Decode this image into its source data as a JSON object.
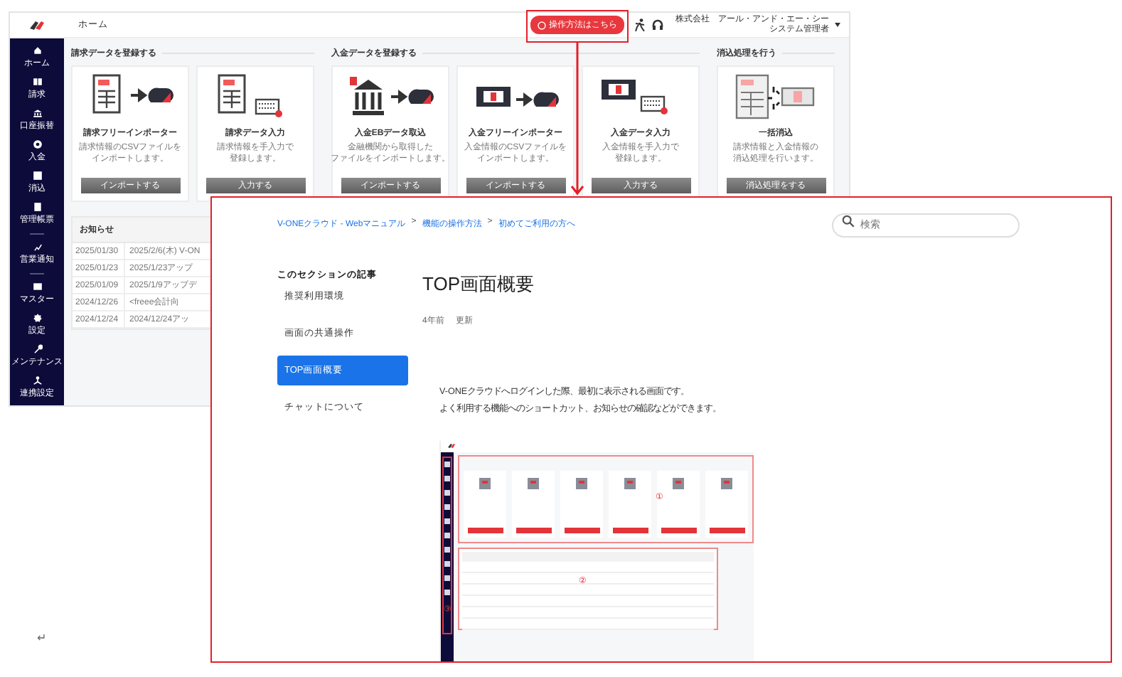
{
  "app": {
    "title": "ホーム",
    "help_button": "操作方法はこちら",
    "company": "株式会社　アール・アンド・エー・シー",
    "role": "システム管理者"
  },
  "sidebar": {
    "groups": [
      {
        "items": [
          "ホーム",
          "請求",
          "口座振替",
          "入金",
          "消込",
          "管理帳票"
        ]
      },
      {
        "items": [
          "営業通知"
        ]
      },
      {
        "items": [
          "マスター",
          "設定",
          "メンテナンス",
          "連携設定"
        ]
      }
    ]
  },
  "sections": [
    {
      "title": "請求データを登録する",
      "cards": [
        {
          "title": "請求フリーインポーター",
          "description_lines": [
            "請求情報のCSVファイルを",
            "インポートします。"
          ],
          "button": "インポートする"
        },
        {
          "title": "請求データ入力",
          "description_lines": [
            "請求情報を手入力で",
            "登録します。"
          ],
          "button": "入力する"
        }
      ]
    },
    {
      "title": "入金データを登録する",
      "cards": [
        {
          "title": "入金EBデータ取込",
          "description_lines": [
            "金融機関から取得した",
            "ファイルをインポートします。"
          ],
          "button": "インポートする"
        },
        {
          "title": "入金フリーインポーター",
          "description_lines": [
            "入金情報のCSVファイルを",
            "インポートします。"
          ],
          "button": "インポートする"
        },
        {
          "title": "入金データ入力",
          "description_lines": [
            "入金情報を手入力で",
            "登録します。"
          ],
          "button": "入力する"
        }
      ]
    },
    {
      "title": "消込処理を行う",
      "cards": [
        {
          "title": "一括消込",
          "description_lines": [
            "請求情報と入金情報の",
            "消込処理を行います。"
          ],
          "button": "消込処理をする"
        }
      ]
    }
  ],
  "news": {
    "title": "お知らせ",
    "rows": [
      {
        "date": "2025/01/30",
        "text": "2025/2/6(木) V-ON"
      },
      {
        "date": "2025/01/23",
        "text": "2025/1/23アップ"
      },
      {
        "date": "2025/01/09",
        "text": "2025/1/9アップデ"
      },
      {
        "date": "2024/12/26",
        "text": "<freee会計向"
      },
      {
        "date": "2024/12/24",
        "text": "2024/12/24アッ"
      }
    ]
  },
  "manual": {
    "breadcrumb": [
      {
        "kind": "link",
        "label": "V-ONEクラウド - Webマニュアル"
      },
      {
        "kind": "separator",
        "label": ">"
      },
      {
        "kind": "link",
        "label": "機能の操作方法"
      },
      {
        "kind": "separator",
        "label": ">"
      },
      {
        "kind": "link",
        "label": "初めてご利用の方へ"
      }
    ],
    "search": {
      "placeholder": "検索"
    },
    "nav_heading": "このセクションの記事",
    "nav_items": [
      {
        "label": "推奨利用環境",
        "selected": false
      },
      {
        "label": "画面の共通操作",
        "selected": false
      },
      {
        "label": "TOP画面概要",
        "selected": true
      },
      {
        "label": "チャットについて",
        "selected": false
      }
    ],
    "title": "TOP画面概要",
    "meta": [
      "4年前",
      "更新"
    ],
    "body_lines": [
      "V-ONEクラウドへログインした際、最初に表示される画面です。",
      "よく利用する機能へのショートカット、お知らせの確認などができます。"
    ],
    "screenshot": {
      "markers": [
        "①",
        "②",
        "③"
      ]
    }
  },
  "footer_mark": "↵"
}
